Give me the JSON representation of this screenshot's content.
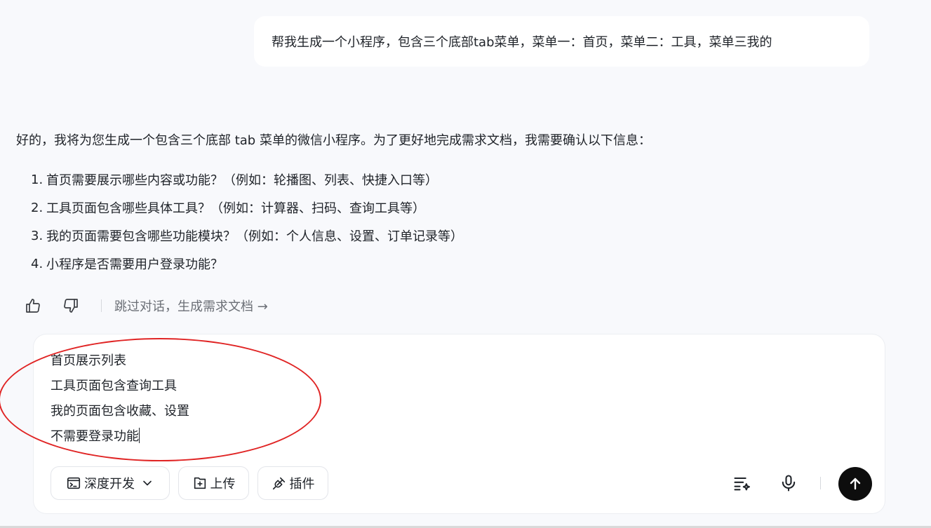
{
  "user_message": "帮我生成一个小程序，包含三个底部tab菜单，菜单一：首页，菜单二：工具，菜单三我的",
  "assistant": {
    "intro": "好的，我将为您生成一个包含三个底部 tab 菜单的微信小程序。为了更好地完成需求文档，我需要确认以下信息：",
    "questions": [
      {
        "num": "1.",
        "text": "首页需要展示哪些内容或功能？（例如：轮播图、列表、快捷入口等）"
      },
      {
        "num": "2.",
        "text": "工具页面包含哪些具体工具？（例如：计算器、扫码、查询工具等）"
      },
      {
        "num": "3.",
        "text": "我的页面需要包含哪些功能模块？（例如：个人信息、设置、订单记录等）"
      },
      {
        "num": "4.",
        "text": "小程序是否需要用户登录功能？"
      }
    ]
  },
  "feedback": {
    "like_icon": "thumbs-up-icon",
    "dislike_icon": "thumbs-down-icon",
    "skip_label": "跳过对话，生成需求文档 →"
  },
  "composer": {
    "lines": [
      "首页展示列表",
      "工具页面包含查询工具",
      "我的页面包含收藏、设置",
      "不需要登录功能"
    ],
    "deep_dev_label": "深度开发",
    "upload_label": "上传",
    "plugin_label": "插件",
    "icons": [
      "terminal-icon",
      "chevron-down-icon",
      "add-file-icon",
      "plugin-icon",
      "prompt-sparkle-icon",
      "microphone-icon",
      "arrow-up-icon"
    ]
  },
  "colors": {
    "background": "#f8f9fc",
    "annotation": "#e02424",
    "send_button": "#0d0d0d"
  }
}
